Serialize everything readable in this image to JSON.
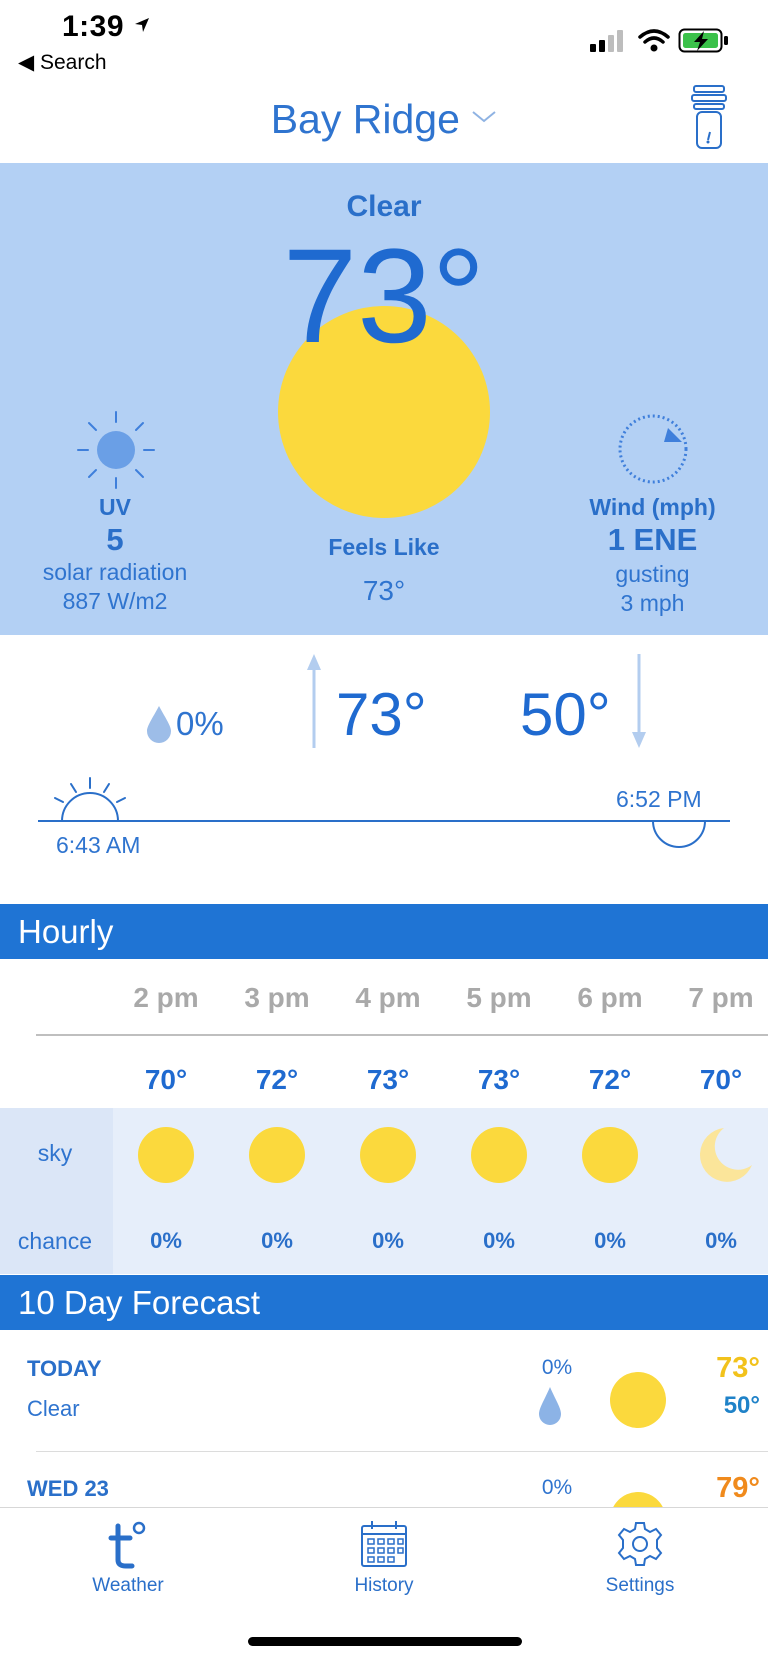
{
  "status_bar": {
    "time": "1:39",
    "back_label": "◀ Search"
  },
  "header": {
    "location": "Bay Ridge"
  },
  "current": {
    "condition": "Clear",
    "temperature": "73°",
    "feels_like_label": "Feels Like",
    "feels_like_value": "73°",
    "uv_label": "UV",
    "uv_value": "5",
    "solar_label": "solar radiation",
    "solar_value": "887 W/m2",
    "wind_label": "Wind (mph)",
    "wind_value": "1 ENE",
    "gust_label": "gusting",
    "gust_value": "3 mph"
  },
  "today": {
    "precip": "0%",
    "high": "73°",
    "low": "50°",
    "sunrise": "6:43 AM",
    "sunset": "6:52 PM"
  },
  "hourly": {
    "title": "Hourly",
    "sky_label": "sky",
    "chance_label": "chance",
    "hours": [
      {
        "time": "2 pm",
        "temp": "70°",
        "icon": "sun-icon",
        "chance": "0%"
      },
      {
        "time": "3 pm",
        "temp": "72°",
        "icon": "sun-icon",
        "chance": "0%"
      },
      {
        "time": "4 pm",
        "temp": "73°",
        "icon": "sun-icon",
        "chance": "0%"
      },
      {
        "time": "5 pm",
        "temp": "73°",
        "icon": "sun-icon",
        "chance": "0%"
      },
      {
        "time": "6 pm",
        "temp": "72°",
        "icon": "sun-icon",
        "chance": "0%"
      },
      {
        "time": "7 pm",
        "temp": "70°",
        "icon": "moon-icon",
        "chance": "0%"
      }
    ]
  },
  "forecast": {
    "title": "10 Day Forecast",
    "days": [
      {
        "day": "TODAY",
        "condition": "Clear",
        "precip": "0%",
        "high": "73°",
        "low": "50°",
        "icon": "sun-icon"
      },
      {
        "day": "WED 23",
        "precip": "0%",
        "high": "79°",
        "icon": "sun-icon"
      }
    ]
  },
  "tabs": [
    {
      "label": "Weather",
      "icon": "thermometer-t-icon"
    },
    {
      "label": "History",
      "icon": "calendar-icon"
    },
    {
      "label": "Settings",
      "icon": "gear-icon"
    }
  ],
  "colors": {
    "accent": "#1f74d4",
    "hero_bg": "#b3d0f4",
    "sun": "#fbd93d",
    "high_today": "#f2c21b",
    "high_wed": "#f08a1c",
    "low": "#1f82c8"
  }
}
